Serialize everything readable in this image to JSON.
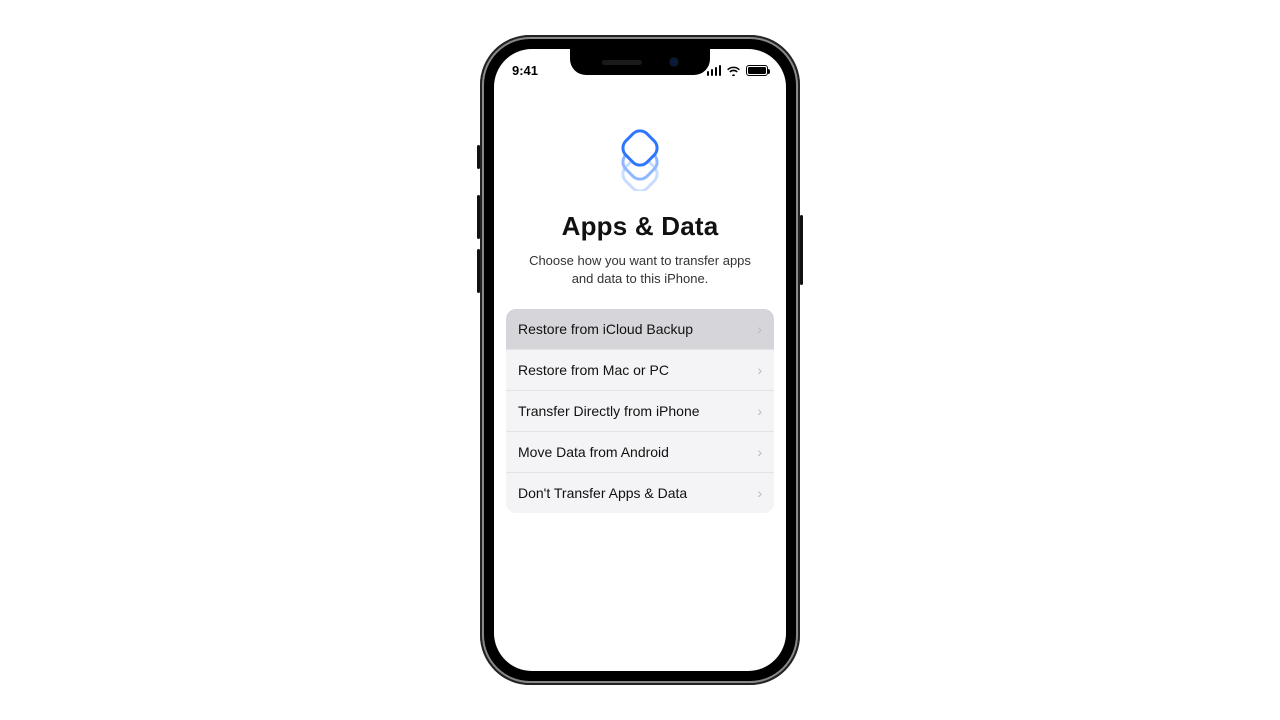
{
  "status": {
    "time": "9:41"
  },
  "header": {
    "title": "Apps & Data",
    "subtitle": "Choose how you want to transfer apps and data to this iPhone."
  },
  "options": [
    {
      "label": "Restore from iCloud Backup",
      "selected": true
    },
    {
      "label": "Restore from Mac or PC",
      "selected": false
    },
    {
      "label": "Transfer Directly from iPhone",
      "selected": false
    },
    {
      "label": "Move Data from Android",
      "selected": false
    },
    {
      "label": "Don't Transfer Apps & Data",
      "selected": false
    }
  ],
  "colors": {
    "accent": "#2f76ff"
  }
}
